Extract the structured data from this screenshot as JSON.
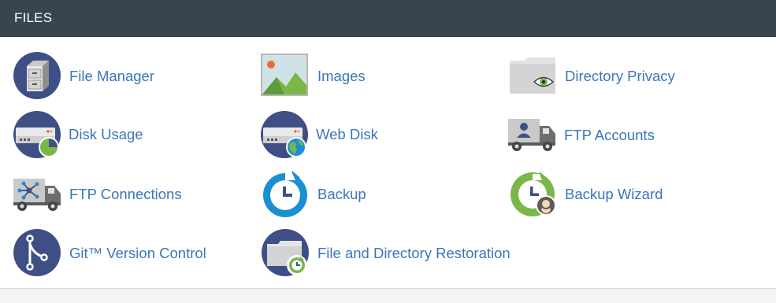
{
  "section": {
    "title": "FILES"
  },
  "tools": {
    "file_manager": "File Manager",
    "images": "Images",
    "directory_privacy": "Directory Privacy",
    "disk_usage": "Disk Usage",
    "web_disk": "Web Disk",
    "ftp_accounts": "FTP Accounts",
    "ftp_connections": "FTP Connections",
    "backup": "Backup",
    "backup_wizard": "Backup Wizard",
    "git_version_control": "Git™ Version Control",
    "file_directory_restoration": "File and Directory Restoration"
  },
  "colors": {
    "header_bg": "#36454f",
    "link": "#3a76b8",
    "icon_navy": "#3f4f86",
    "icon_blue": "#1a8fd1",
    "icon_green": "#7ab648",
    "icon_gray": "#9e9e9e"
  },
  "icons": {
    "file_manager": "file-cabinet-icon",
    "images": "picture-icon",
    "directory_privacy": "folder-eye-icon",
    "disk_usage": "drive-pie-icon",
    "web_disk": "drive-globe-icon",
    "ftp_accounts": "truck-user-icon",
    "ftp_connections": "truck-network-icon",
    "backup": "clock-refresh-icon",
    "backup_wizard": "clock-wizard-icon",
    "git_version_control": "git-branch-icon",
    "file_directory_restoration": "folder-clock-icon"
  }
}
